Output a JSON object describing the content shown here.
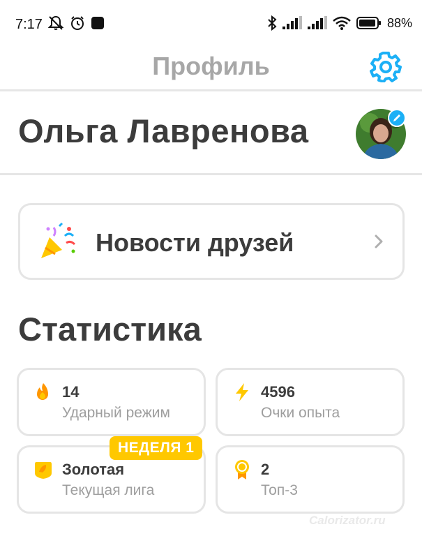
{
  "status_bar": {
    "time": "7:17",
    "battery": "88",
    "battery_suffix": "%",
    "icons": [
      "notifications-off-icon",
      "alarm-icon",
      "app-square-icon",
      "bluetooth-icon",
      "signal-icon",
      "signal-icon",
      "wifi-icon",
      "battery-icon"
    ]
  },
  "header": {
    "title": "Профиль",
    "settings_icon": "gear-icon"
  },
  "profile": {
    "name": "Ольга Лавренова",
    "avatar_edit_icon": "pencil-icon"
  },
  "friends_card": {
    "label": "Новости друзей",
    "icon": "party-popper-icon"
  },
  "stats": {
    "title": "Статистика",
    "items": [
      {
        "value": "14",
        "label": "Ударный режим",
        "icon": "flame-icon"
      },
      {
        "value": "4596",
        "label": "Очки опыта",
        "icon": "lightning-icon"
      },
      {
        "value": "Золотая",
        "label": "Текущая лига",
        "icon": "gold-league-icon"
      },
      {
        "value": "2",
        "label": "Топ-3",
        "icon": "medal-icon"
      }
    ],
    "league_badge": "НЕДЕЛЯ 1"
  },
  "watermark": "Calorizator.ru",
  "colors": {
    "accent_blue": "#1cb0f6",
    "gold": "#ffc800",
    "flame": "#ff9600",
    "text_dark": "#3c3c3c",
    "text_muted": "#9e9e9e",
    "border": "#e5e5e5"
  }
}
